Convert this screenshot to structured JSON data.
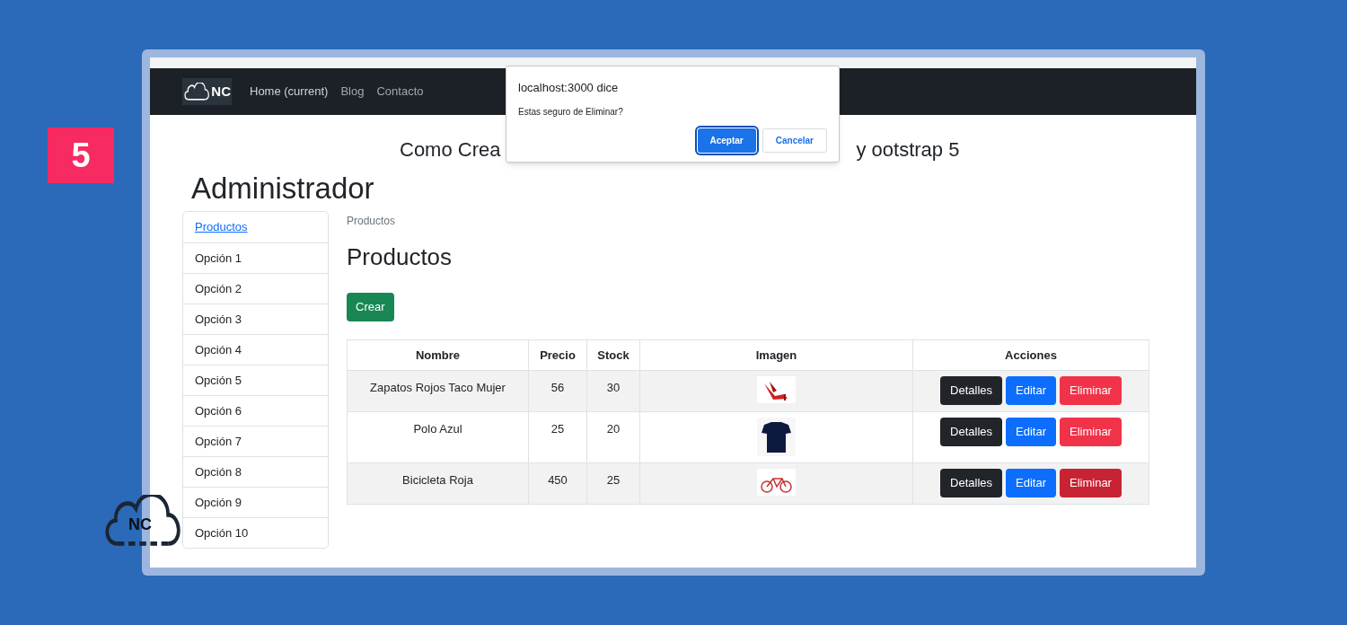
{
  "slide": {
    "badge": "5",
    "logo": "NC"
  },
  "navbar": {
    "brand": "NC",
    "links": [
      {
        "label": "Home (current)",
        "selected": true
      },
      {
        "label": "Blog",
        "selected": false
      },
      {
        "label": "Contacto",
        "selected": false
      }
    ]
  },
  "dialog": {
    "title": "localhost:3000 dice",
    "message": "Estas seguro de Eliminar?",
    "buttons": [
      {
        "label": "Aceptar",
        "kind": "primary"
      },
      {
        "label": "Cancelar",
        "kind": "secondary"
      }
    ]
  },
  "page_title": {
    "before_dialog": "Como Crea",
    "after_dialog": "y ootstrap 5"
  },
  "heading": "Administrador",
  "sidebar": {
    "items": [
      {
        "label": "Productos",
        "selected": true
      },
      {
        "label": "Opción 1",
        "selected": false
      },
      {
        "label": "Opción 2",
        "selected": false
      },
      {
        "label": "Opción 3",
        "selected": false
      },
      {
        "label": "Opción 4",
        "selected": false
      },
      {
        "label": "Opción 5",
        "selected": false
      },
      {
        "label": "Opción 6",
        "selected": false
      },
      {
        "label": "Opción 7",
        "selected": false
      },
      {
        "label": "Opción 8",
        "selected": false
      },
      {
        "label": "Opción 9",
        "selected": false
      },
      {
        "label": "Opción 10",
        "selected": false
      }
    ]
  },
  "breadcrumb": "Productos",
  "section_title": "Productos",
  "create_button": "Crear",
  "table": {
    "columns": [
      "Nombre",
      "Precio",
      "Stock",
      "Imagen",
      "Acciones"
    ],
    "rows": [
      {
        "name": "Zapatos Rojos Taco Mujer",
        "price": "56",
        "stock": "30",
        "actions": [
          {
            "label": "Detalles",
            "kind": "dark",
            "hovered": false
          },
          {
            "label": "Editar",
            "kind": "primary",
            "hovered": false
          },
          {
            "label": "Eliminar",
            "kind": "danger",
            "hovered": false
          }
        ]
      },
      {
        "name": "Polo Azul",
        "price": "25",
        "stock": "20",
        "actions": [
          {
            "label": "Detalles",
            "kind": "dark",
            "hovered": false
          },
          {
            "label": "Editar",
            "kind": "primary",
            "hovered": false
          },
          {
            "label": "Eliminar",
            "kind": "danger",
            "hovered": false
          }
        ]
      },
      {
        "name": "Bicicleta Roja",
        "price": "450",
        "stock": "25",
        "actions": [
          {
            "label": "Detalles",
            "kind": "dark",
            "hovered": false
          },
          {
            "label": "Editar",
            "kind": "primary",
            "hovered": false
          },
          {
            "label": "Eliminar",
            "kind": "danger",
            "hovered": true
          }
        ]
      }
    ]
  }
}
